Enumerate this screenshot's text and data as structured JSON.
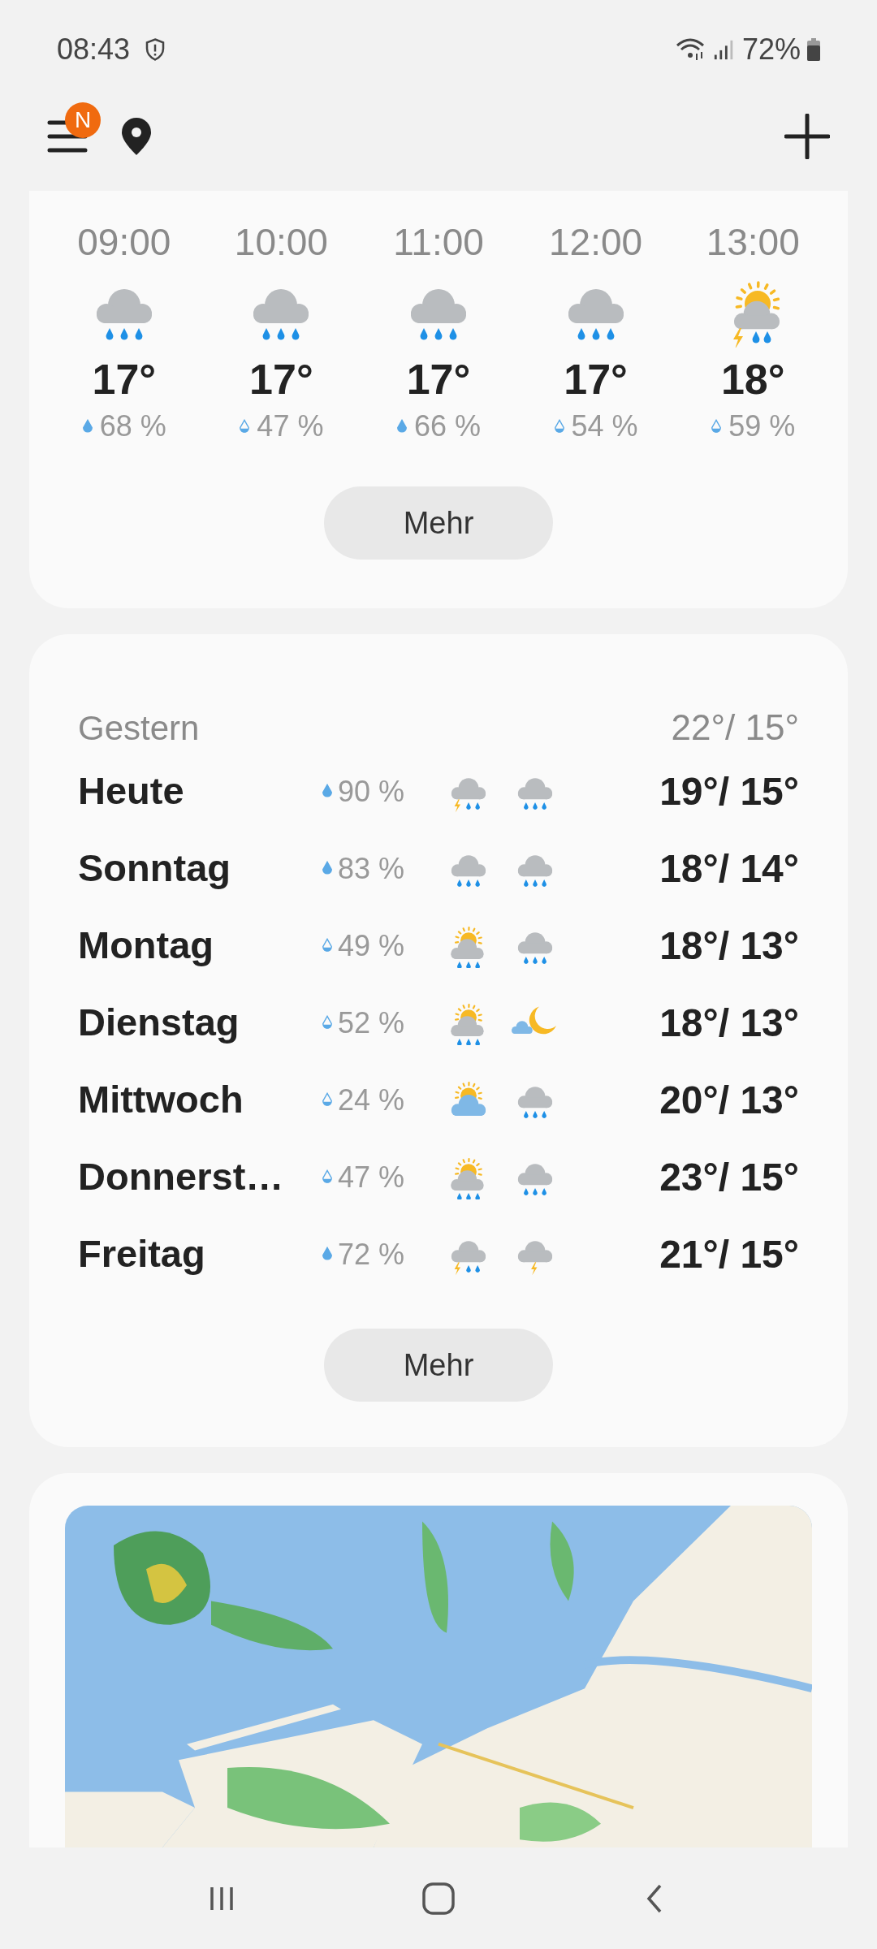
{
  "status_bar": {
    "time": "08:43",
    "battery": "72%"
  },
  "header": {
    "menu_badge": "N"
  },
  "hourly": {
    "hours": [
      {
        "time": "09:00",
        "kind": "rain",
        "temp": "17°",
        "precip": {
          "value": "68 %",
          "kind": "full"
        }
      },
      {
        "time": "10:00",
        "kind": "rain",
        "temp": "17°",
        "precip": {
          "value": "47 %",
          "kind": "half"
        }
      },
      {
        "time": "11:00",
        "kind": "rain",
        "temp": "17°",
        "precip": {
          "value": "66 %",
          "kind": "full"
        }
      },
      {
        "time": "12:00",
        "kind": "rain",
        "temp": "17°",
        "precip": {
          "value": "54 %",
          "kind": "half"
        }
      },
      {
        "time": "13:00",
        "kind": "sun-thunder-rain",
        "temp": "18°",
        "precip": {
          "value": "59 %",
          "kind": "half"
        }
      }
    ],
    "more_button": "Mehr"
  },
  "daily": {
    "yesterday": {
      "label": "Gestern",
      "temps": "22°/ 15°"
    },
    "days": [
      {
        "day": "Heute",
        "precip": {
          "value": "90 %",
          "kind": "full"
        },
        "icons": [
          {
            "kind": "thunder-rain"
          },
          {
            "kind": "rain"
          }
        ],
        "temps": "19°/ 15°"
      },
      {
        "day": "Sonntag",
        "precip": {
          "value": "83 %",
          "kind": "full"
        },
        "icons": [
          {
            "kind": "rain"
          },
          {
            "kind": "rain"
          }
        ],
        "temps": "18°/ 14°"
      },
      {
        "day": "Montag",
        "precip": {
          "value": "49 %",
          "kind": "half"
        },
        "icons": [
          {
            "kind": "sun-rain"
          },
          {
            "kind": "rain"
          }
        ],
        "temps": "18°/ 13°"
      },
      {
        "day": "Dienstag",
        "precip": {
          "value": "52 %",
          "kind": "half"
        },
        "icons": [
          {
            "kind": "sun-rain"
          },
          {
            "kind": "moon-cloud"
          }
        ],
        "temps": "18°/ 13°"
      },
      {
        "day": "Mittwoch",
        "precip": {
          "value": "24 %",
          "kind": "half"
        },
        "icons": [
          {
            "kind": "sun-cloud"
          },
          {
            "kind": "rain"
          }
        ],
        "temps": "20°/ 13°"
      },
      {
        "day": "Donnerst…",
        "precip": {
          "value": "47 %",
          "kind": "half"
        },
        "icons": [
          {
            "kind": "sun-rain"
          },
          {
            "kind": "rain"
          }
        ],
        "temps": "23°/ 15°"
      },
      {
        "day": "Freitag",
        "precip": {
          "value": "72 %",
          "kind": "full"
        },
        "icons": [
          {
            "kind": "thunder-rain"
          },
          {
            "kind": "thunder"
          }
        ],
        "temps": "21°/ 15°"
      }
    ],
    "more_button": "Mehr"
  }
}
